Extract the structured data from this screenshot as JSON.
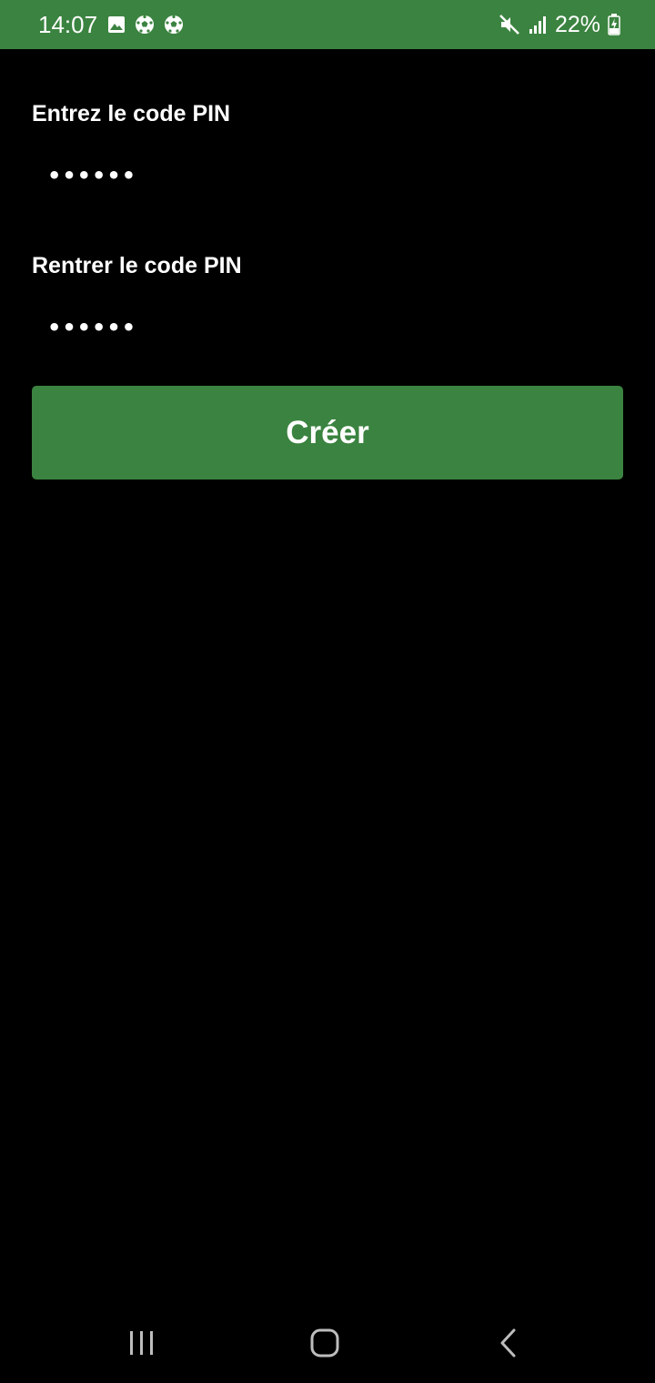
{
  "status_bar": {
    "time": "14:07",
    "notification_icons": [
      "image-icon",
      "soccer-ball-icon",
      "soccer-ball-icon"
    ],
    "system_icons": [
      "mute-icon",
      "signal-icon",
      "battery-charging-icon"
    ],
    "battery_percent": "22%",
    "background_color": "#3b8340"
  },
  "form": {
    "pin_label": "Entrez le code PIN",
    "pin_value": "••••••",
    "confirm_label": "Rentrer le code PIN",
    "confirm_value": "••••••",
    "submit_label": "Créer",
    "accent_color": "#3b8340"
  },
  "nav_bar": {
    "buttons": [
      "recents-icon",
      "home-icon",
      "back-icon"
    ]
  }
}
